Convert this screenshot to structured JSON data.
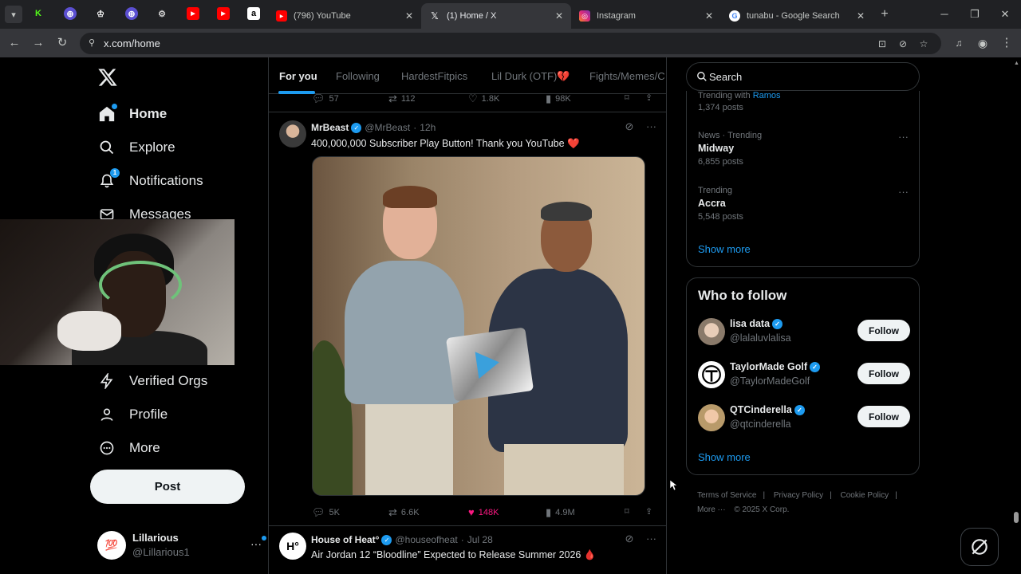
{
  "browser": {
    "tabs": [
      {
        "title": "(796) YouTube",
        "favicon": "youtube-icon"
      },
      {
        "title": "(1) Home / X",
        "favicon": "x-icon",
        "active": true
      },
      {
        "title": "Instagram",
        "favicon": "instagram-icon"
      },
      {
        "title": "tunabu - Google Search",
        "favicon": "google-icon"
      }
    ],
    "url": "x.com/home"
  },
  "nav": {
    "items": [
      {
        "label": "Home",
        "icon": "home-icon"
      },
      {
        "label": "Explore",
        "icon": "search-icon"
      },
      {
        "label": "Notifications",
        "icon": "bell-icon",
        "badge": "1"
      },
      {
        "label": "Messages",
        "icon": "mail-icon"
      },
      {
        "label": "Verified Orgs",
        "icon": "lightning-icon"
      },
      {
        "label": "Profile",
        "icon": "person-icon"
      },
      {
        "label": "More",
        "icon": "more-circle-icon"
      }
    ],
    "post_label": "Post",
    "account": {
      "name": "Lillarious",
      "handle": "@Lillarious1",
      "avatar_text": "💯"
    }
  },
  "feed_tabs": [
    "For you",
    "Following",
    "HardestFitpics",
    "Lil Durk (OTF)💔",
    "Fights/Memes/C"
  ],
  "prev_tweet_stats": {
    "replies": "57",
    "retweets": "112",
    "likes": "1.8K",
    "views": "98K"
  },
  "tweets": [
    {
      "name": "MrBeast",
      "handle": "@MrBeast",
      "time": "12h",
      "text": "400,000,000 Subscriber Play Button! Thank you YouTube ❤️",
      "replies": "5K",
      "retweets": "6.6K",
      "likes": "148K",
      "views": "4.9M"
    },
    {
      "name": "House of Heat°",
      "handle": "@houseofheat",
      "time": "Jul 28",
      "text": "Air Jordan 12 “Bloodline” Expected to Release Summer 2026 🩸"
    }
  ],
  "search": {
    "placeholder": "Search"
  },
  "trending": {
    "first": {
      "context_prefix": "Trending with",
      "context_link": "Ramos",
      "count": "1,374 posts"
    },
    "items": [
      {
        "context": "News · Trending",
        "name": "Midway",
        "count": "6,855 posts"
      },
      {
        "context": "Trending",
        "name": "Accra",
        "count": "5,548 posts"
      }
    ],
    "show_more": "Show more"
  },
  "who_to_follow": {
    "title": "Who to follow",
    "accounts": [
      {
        "name": "lisa data",
        "handle": "@lalaluvlalisa",
        "button": "Follow"
      },
      {
        "name": "TaylorMade Golf",
        "handle": "@TaylorMadeGolf",
        "button": "Follow"
      },
      {
        "name": "QTCinderella",
        "handle": "@qtcinderella",
        "button": "Follow"
      }
    ],
    "show_more": "Show more"
  },
  "footer": {
    "links": [
      "Terms of Service",
      "Privacy Policy",
      "Cookie Policy"
    ],
    "more": "More ···",
    "copyright": "© 2025 X Corp."
  },
  "colors": {
    "accent": "#1d9bf0",
    "like": "#f91880",
    "background": "#000000"
  }
}
